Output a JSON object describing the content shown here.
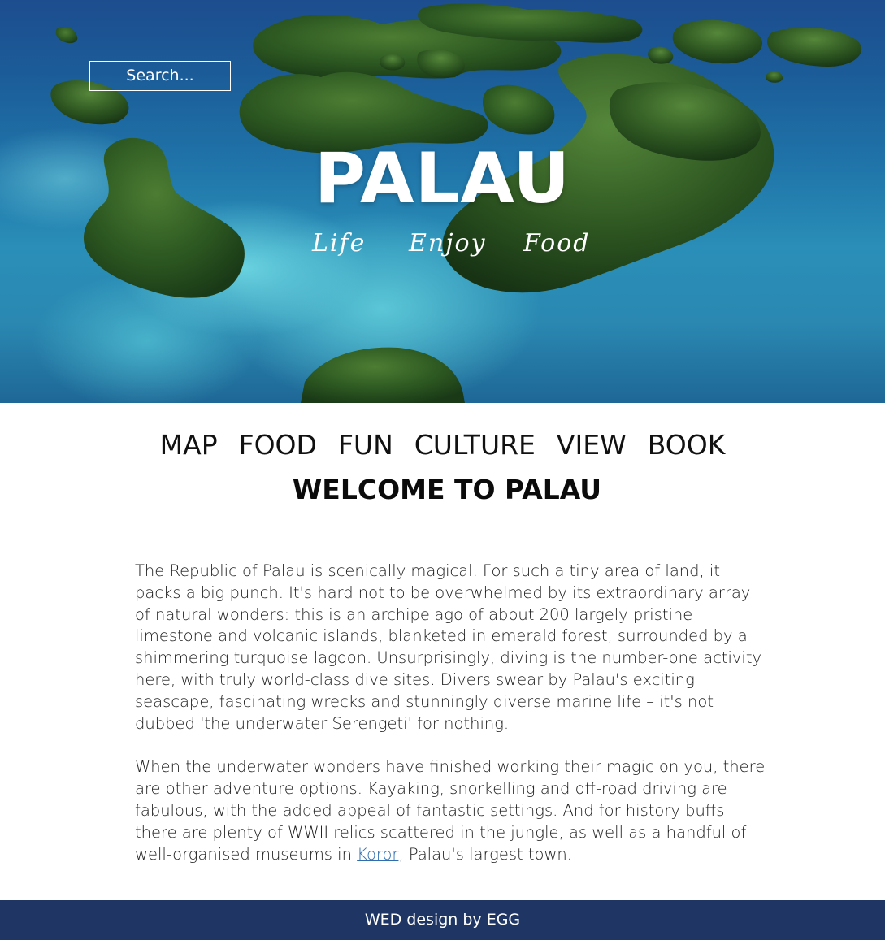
{
  "hero": {
    "search_placeholder": "Search...",
    "title": "PALAU",
    "taglines": [
      "Life",
      "Enjoy",
      "Food"
    ]
  },
  "nav": {
    "items": [
      "MAP",
      "FOOD",
      "FUN",
      "CULTURE",
      "VIEW",
      "BOOK"
    ]
  },
  "main": {
    "heading": "WELCOME TO PALAU",
    "paragraph1": "The Republic of Palau is scenically magical. For such a tiny area of land, it packs a big punch. It's hard not to be overwhelmed by its extraordinary array of natural wonders: this is an archipelago of about 200 largely pristine limestone and volcanic islands, blanketed in emerald forest, surrounded by a shimmering turquoise lagoon. Unsurprisingly, diving is the number-one activity here, with truly world-class dive sites. Divers swear by Palau's exciting seascape, fascinating wrecks and stunningly diverse marine life – it's not dubbed 'the underwater Serengeti' for nothing.",
    "paragraph2_before": "When the underwater wonders have finished working their magic on you, there are other adventure options. Kayaking, snorkelling and off-road driving are fabulous, with the added appeal of fantastic settings. And for history buffs there are plenty of WWII relics scattered in the jungle, as well as a handful of well-organised museums in ",
    "paragraph2_link": "Koror",
    "paragraph2_after": ", Palau's largest town."
  },
  "footer": {
    "text": "WED design by EGG"
  },
  "colors": {
    "footer_bg": "#1f3563",
    "link": "#2e6db0",
    "ocean_deep": "#1d4d8e",
    "lagoon": "#74dee6",
    "island": "#2f5a23"
  }
}
